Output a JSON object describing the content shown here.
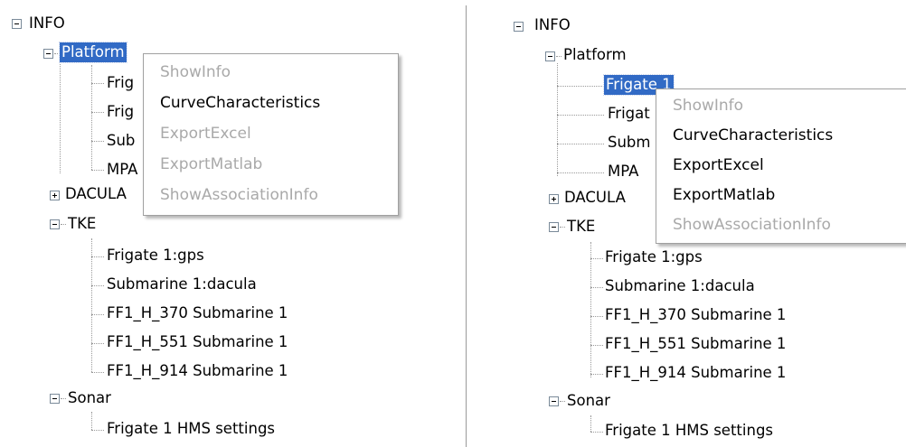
{
  "left": {
    "root": "INFO",
    "platform": {
      "label": "Platform",
      "children_visible": [
        "Frig",
        "Frig",
        "Sub",
        "MPA"
      ]
    },
    "dacula": "DACULA",
    "tke": {
      "label": "TKE",
      "children": [
        "Frigate 1:gps",
        "Submarine 1:dacula",
        "FF1_H_370 Submarine 1",
        "FF1_H_551 Submarine 1",
        "FF1_H_914 Submarine 1"
      ]
    },
    "sonar": {
      "label": "Sonar",
      "children": [
        "Frigate 1 HMS settings"
      ]
    },
    "context_menu": {
      "items": [
        {
          "label": "ShowInfo",
          "enabled": false
        },
        {
          "label": "CurveCharacteristics",
          "enabled": true
        },
        {
          "label": "ExportExcel",
          "enabled": false
        },
        {
          "label": "ExportMatlab",
          "enabled": false
        },
        {
          "label": "ShowAssociationInfo",
          "enabled": false
        }
      ]
    }
  },
  "right": {
    "root": "INFO",
    "platform": {
      "label": "Platform",
      "selected_child": "Frigate 1",
      "children_visible": [
        "Frigat",
        "Subm",
        "MPA"
      ]
    },
    "dacula": "DACULA",
    "tke": {
      "label": "TKE",
      "children": [
        "Frigate 1:gps",
        "Submarine 1:dacula",
        "FF1_H_370 Submarine 1",
        "FF1_H_551 Submarine 1",
        "FF1_H_914 Submarine 1"
      ]
    },
    "sonar": {
      "label": "Sonar",
      "children": [
        "Frigate 1 HMS settings"
      ]
    },
    "context_menu": {
      "items": [
        {
          "label": "ShowInfo",
          "enabled": false
        },
        {
          "label": "CurveCharacteristics",
          "enabled": true
        },
        {
          "label": "ExportExcel",
          "enabled": true
        },
        {
          "label": "ExportMatlab",
          "enabled": true
        },
        {
          "label": "ShowAssociationInfo",
          "enabled": false
        }
      ]
    }
  },
  "colors": {
    "selection": "#316ac5",
    "disabled_text": "#a9a9a9",
    "tree_lines": "#9a9a9a"
  }
}
